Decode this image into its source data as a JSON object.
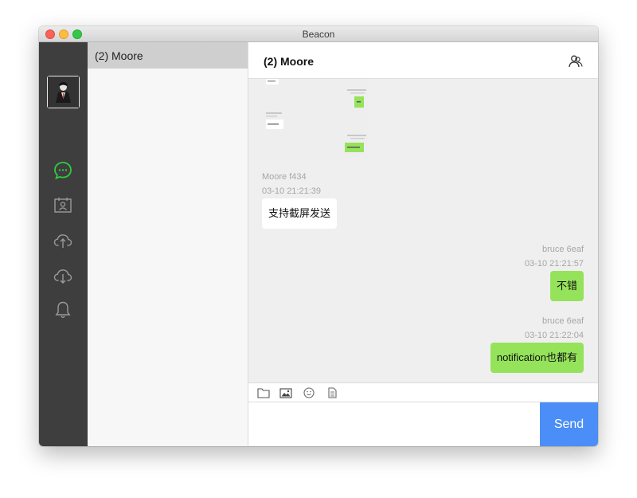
{
  "window": {
    "title": "Beacon"
  },
  "sidebar": {
    "icons": [
      "avatar",
      "chat-icon",
      "contacts-icon",
      "upload-icon",
      "download-icon",
      "bell-icon"
    ],
    "active_color": "#2ecc40"
  },
  "conversation_list": {
    "items": [
      {
        "name": "(2) Moore"
      }
    ]
  },
  "chat": {
    "title": "(2) Moore",
    "messages": [
      {
        "sender": "Moore f434",
        "time": "03-10 21:21:39",
        "text": "支持截屏发送",
        "direction": "incoming"
      },
      {
        "sender": "bruce 6eaf",
        "time": "03-10 21:21:57",
        "text": "不错",
        "direction": "outgoing"
      },
      {
        "sender": "bruce 6eaf",
        "time": "03-10 21:22:04",
        "text": "notification也都有",
        "direction": "outgoing"
      }
    ]
  },
  "toolbar": {
    "icons": [
      "folder-icon",
      "image-icon",
      "emoji-icon",
      "file-icon"
    ]
  },
  "composer": {
    "value": "",
    "send_label": "Send"
  },
  "colors": {
    "accent": "#4b8ef7",
    "outgoing_bubble": "#95e35a",
    "sidebar": "#3e3e3e"
  }
}
